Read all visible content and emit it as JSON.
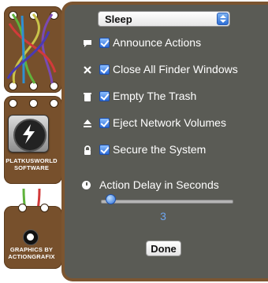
{
  "power_action": {
    "selected": "Sleep"
  },
  "actions": [
    {
      "label": "Announce Actions",
      "checked": true,
      "icon": "speech-bubble-icon"
    },
    {
      "label": "Close All Finder Windows",
      "checked": true,
      "icon": "close-x-icon"
    },
    {
      "label": "Empty The Trash",
      "checked": true,
      "icon": "trash-icon"
    },
    {
      "label": "Eject Network Volumes",
      "checked": true,
      "icon": "eject-icon"
    },
    {
      "label": "Secure the System",
      "checked": true,
      "icon": "lock-icon"
    }
  ],
  "delay": {
    "label": "Action Delay in Seconds",
    "value": "3",
    "fraction": 0.04,
    "icon": "clock-icon"
  },
  "branding": {
    "company": [
      "PLATKUSWORLD",
      "SOFTWARE"
    ],
    "credit": [
      "GRAPHICS BY",
      "ACTIONGRAFIX"
    ]
  },
  "done_label": "Done",
  "colors": {
    "panel": "#5a5b55",
    "frame": "#7c5530",
    "accent": "#2e6fd6",
    "value_text": "#6fa6ef"
  }
}
